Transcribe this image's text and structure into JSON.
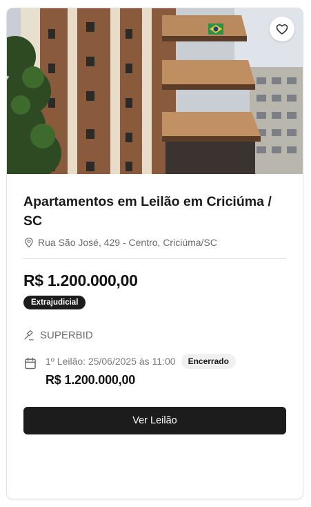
{
  "listing": {
    "photo_alt": "Foto do imóvel",
    "favorite_icon": "heart-icon",
    "title": "Apartamentos em Leilão em Criciúma / SC",
    "address_icon": "map-pin-icon",
    "address": "Rua São José, 429 - Centro, Criciúma/SC",
    "price": "R$ 1.200.000,00",
    "badge": "Extrajudicial",
    "seller_icon": "gavel-icon",
    "seller": "SUPERBID",
    "rounds": [
      {
        "icon": "calendar-icon",
        "label": "1º Leilão: 25/06/2025 às 11:00",
        "status": "Encerrado",
        "price": "R$ 1.200.000,00"
      }
    ],
    "cta_label": "Ver Leilão"
  },
  "colors": {
    "primary_dark": "#1c1c1c",
    "muted_text": "#6b6b6b",
    "status_bg": "#f0f0f0"
  }
}
